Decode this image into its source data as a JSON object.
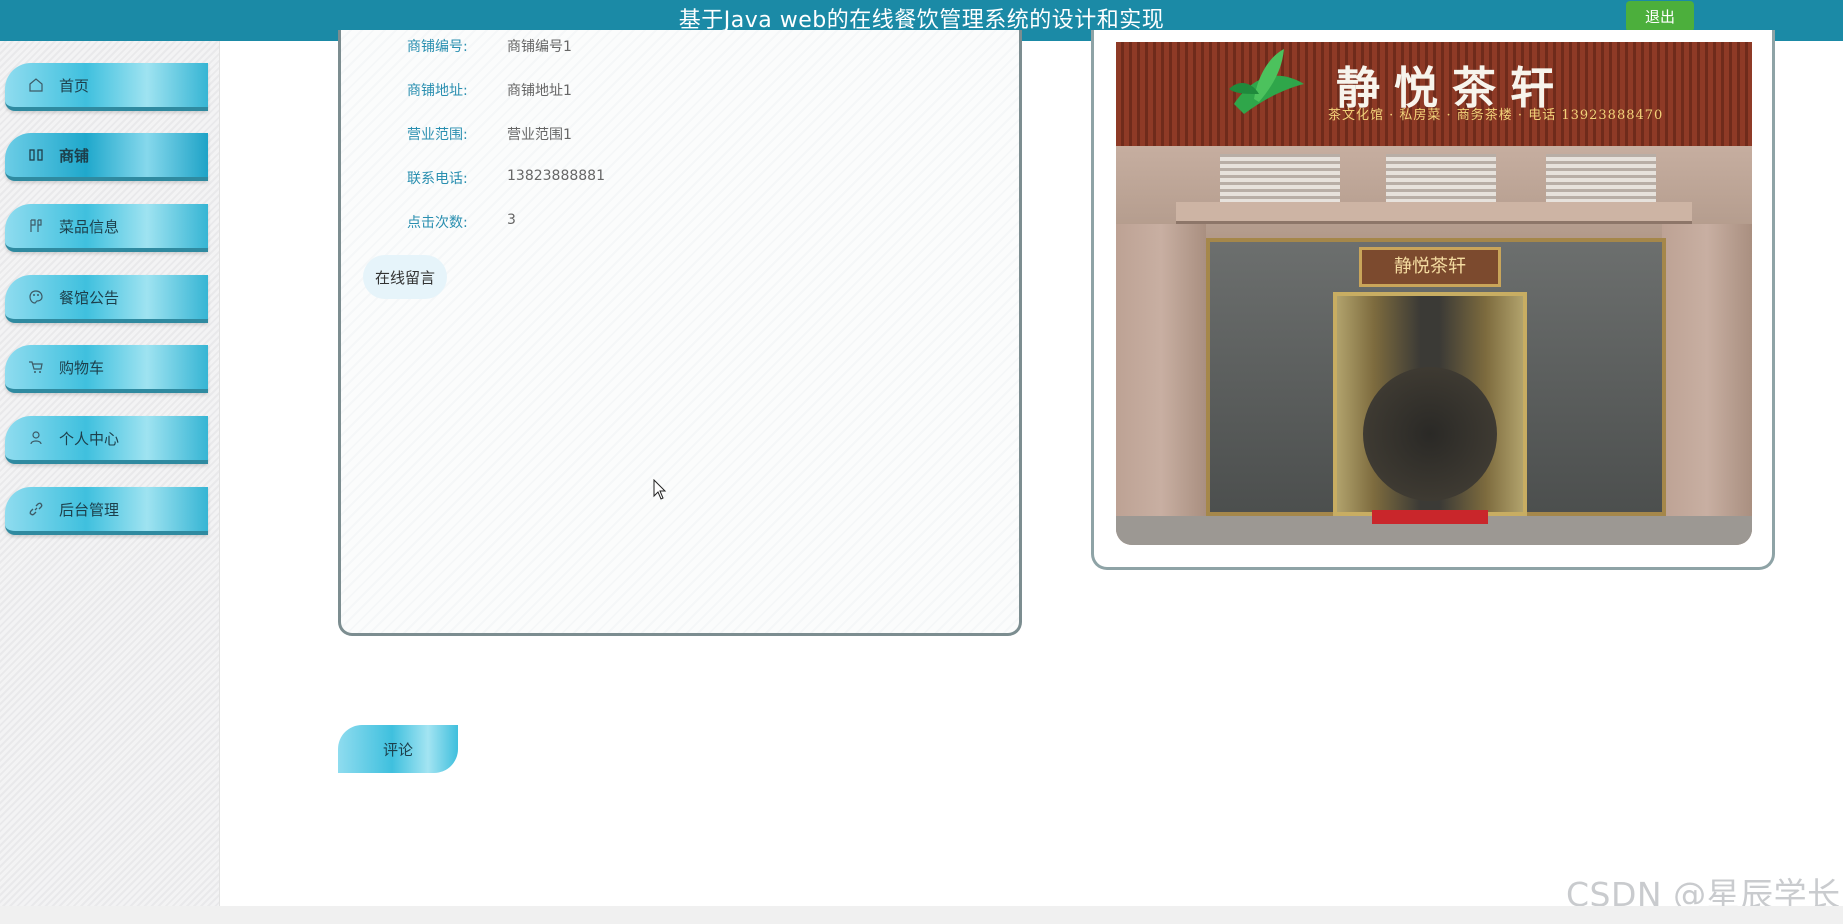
{
  "header": {
    "title": "基于Java web的在线餐饮管理系统的设计和实现",
    "logout_label": "退出",
    "accent_color": "#1b8aa6"
  },
  "sidebar": {
    "items": [
      {
        "label": "首页",
        "icon": "home-icon"
      },
      {
        "label": "商铺",
        "icon": "shop-icon",
        "active": true
      },
      {
        "label": "菜品信息",
        "icon": "dish-icon"
      },
      {
        "label": "餐馆公告",
        "icon": "palette-icon"
      },
      {
        "label": "购物车",
        "icon": "cart-icon"
      },
      {
        "label": "个人中心",
        "icon": "user-icon"
      },
      {
        "label": "后台管理",
        "icon": "link-icon"
      }
    ]
  },
  "detail": {
    "fields": [
      {
        "key": "商铺编号:",
        "value": "商铺编号1"
      },
      {
        "key": "商铺地址:",
        "value": "商铺地址1"
      },
      {
        "key": "营业范围:",
        "value": "营业范围1"
      },
      {
        "key": "联系电话:",
        "value": "13823888881"
      },
      {
        "key": "点击次数:",
        "value": "3"
      }
    ],
    "message_button": "在线留言"
  },
  "photo": {
    "sign_title": "静悦茶轩",
    "sign_subtitle": "茶文化馆 · 私房菜 · 商务茶楼 · 电话 13923888470",
    "plaque": "静悦茶轩"
  },
  "comment_button": "评论",
  "watermark": "CSDN @星辰学长"
}
